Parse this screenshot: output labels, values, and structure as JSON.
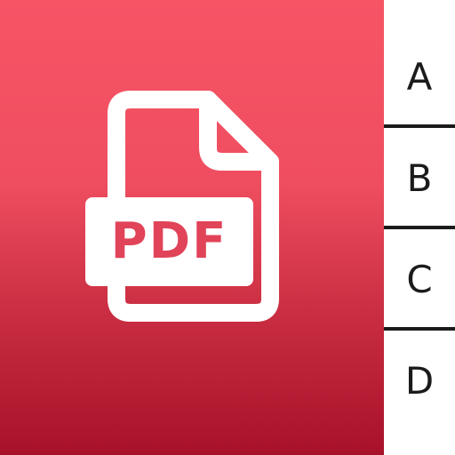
{
  "file_badge": {
    "label": "PDF"
  },
  "index_tabs": [
    {
      "letter": "A"
    },
    {
      "letter": "B"
    },
    {
      "letter": "C"
    },
    {
      "letter": "D"
    }
  ],
  "colors": {
    "brand_red_top": "#f75566",
    "brand_red_bottom": "#a8112a",
    "label_text": "#e14359",
    "divider": "#1b1b1b",
    "index_background": "#ffffff"
  },
  "icons": {
    "main": "pdf-file-icon"
  }
}
